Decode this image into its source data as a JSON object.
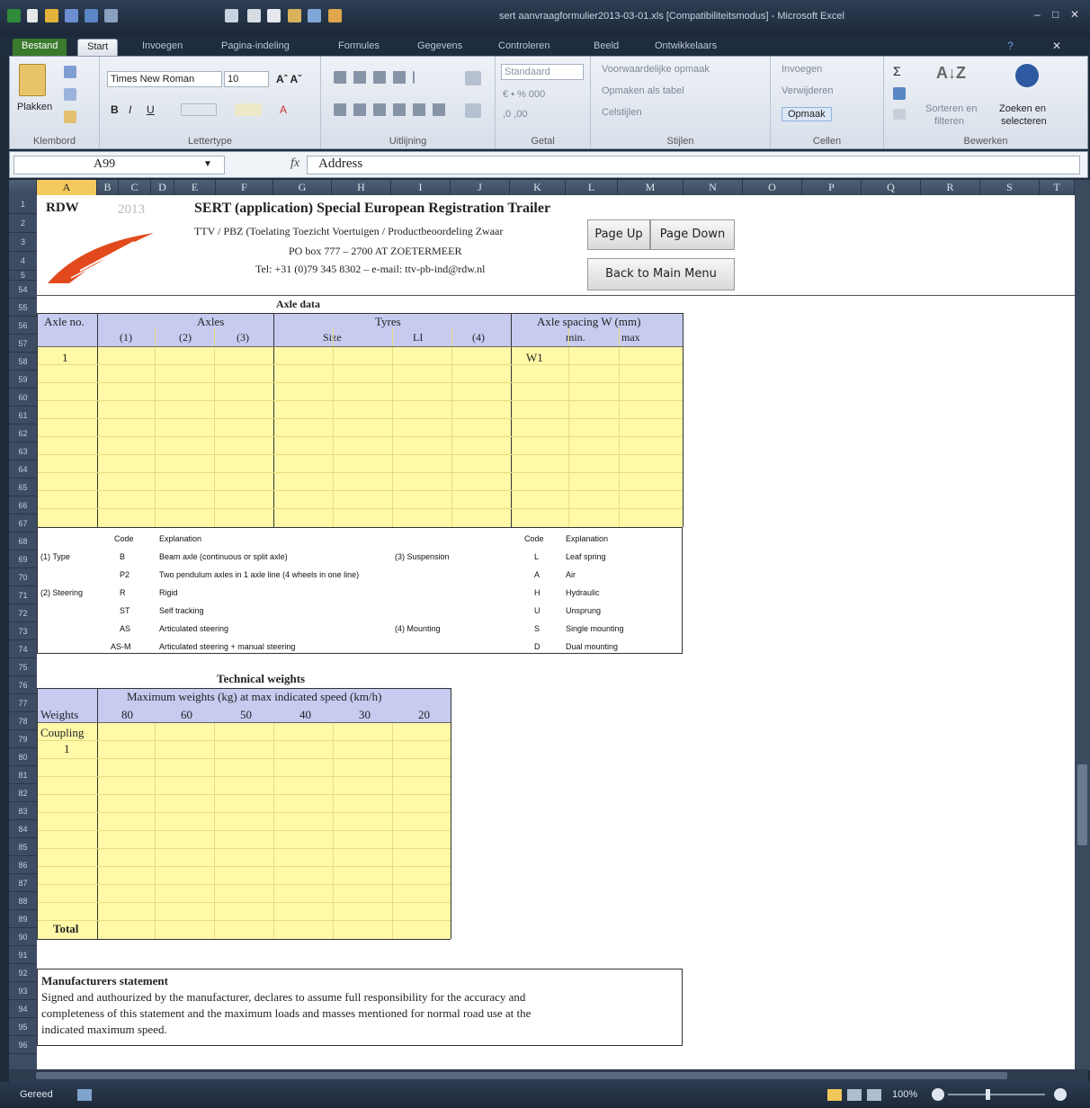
{
  "window": {
    "title": "sert aanvraagformulier2013-03-01.xls  [Compatibiliteitsmodus] - Microsoft Excel"
  },
  "ribbon_tabs": [
    "Bestand",
    "Start",
    "Invoegen",
    "Pagina-indeling",
    "Formules",
    "Gegevens",
    "Controleren",
    "Beeld",
    "Ontwikkelaars"
  ],
  "ribbon": {
    "paste": "Plakken",
    "clipboard": "Klembord",
    "font_name": "Times New Roman",
    "font_size": "10",
    "font_group": "Lettertype",
    "align_group": "Uitlijning",
    "number_format": "Standaard",
    "number_group": "Getal",
    "cond_format": "Voorwaardelijke opmaak",
    "table_format": "Opmaken als tabel",
    "cell_styles": "Celstijlen",
    "styles_group": "Stijlen",
    "insert": "Invoegen",
    "delete": "Verwijderen",
    "format": "Opmaak",
    "cells_group": "Cellen",
    "sort_filter": [
      "Sorteren en",
      "filteren"
    ],
    "find_select": [
      "Zoeken en",
      "selecteren"
    ],
    "edit_group": "Bewerken"
  },
  "formula_bar": {
    "name_box": "A99",
    "fx": "fx",
    "content": "Address"
  },
  "columns": [
    "A",
    "B",
    "C",
    "D",
    "E",
    "F",
    "G",
    "H",
    "I",
    "J",
    "K",
    "L",
    "M",
    "N",
    "O",
    "P",
    "Q",
    "R",
    "S",
    "T"
  ],
  "rows": [
    "1",
    "2",
    "3",
    "4",
    "5",
    "54",
    "55",
    "56",
    "57",
    "58",
    "59",
    "60",
    "61",
    "62",
    "63",
    "64",
    "65",
    "66",
    "67",
    "68",
    "69",
    "70",
    "71",
    "72",
    "73",
    "74",
    "75",
    "76",
    "77",
    "78",
    "79",
    "80",
    "81",
    "82",
    "83",
    "84",
    "85",
    "86",
    "87",
    "88",
    "89",
    "90",
    "91",
    "92",
    "93",
    "94",
    "95",
    "96"
  ],
  "header": {
    "logo": "RDW",
    "year": "2013",
    "title": "SERT (application) Special European Registration Trailer",
    "line1": "TTV / PBZ (Toelating Toezicht Voertuigen / Productbeoordeling Zwaar",
    "line2": "PO box 777 – 2700 AT  ZOETERMEER",
    "line3": "Tel: +31 (0)79 345 8302 – e-mail: ttv-pb-ind@rdw.nl"
  },
  "nav": {
    "page_up": "Page Up",
    "page_down": "Page Down",
    "main_menu": "Back to Main Menu"
  },
  "axle": {
    "section": "Axle data",
    "axle_no": "Axle no.",
    "axles": "Axles",
    "axle_cols": [
      "(1)",
      "(2)",
      "(3)"
    ],
    "tyres": "Tyres",
    "size": "Size",
    "li": "LI",
    "col4": "(4)",
    "spacing": "Axle spacing W (mm)",
    "min": "min.",
    "max": "max",
    "first_no": "1",
    "first_w": "W1"
  },
  "legend": {
    "code_hdr": "Code",
    "expl_hdr": "Explanation",
    "type": "(1) Type",
    "steering": "(2) Steering",
    "suspension": "(3) Suspension",
    "mounting": "(4) Mounting",
    "left": [
      [
        "B",
        "Beam axle (continuous or split axle)"
      ],
      [
        "P2",
        "Two pendulum axles in 1 axle line (4 wheels in one line)"
      ],
      [
        "R",
        "Rigid"
      ],
      [
        "ST",
        "Self tracking"
      ],
      [
        "AS",
        "Articulated steering"
      ],
      [
        "AS-M",
        "Articulated steering + manual steering"
      ]
    ],
    "right": [
      [
        "L",
        "Leaf spring"
      ],
      [
        "A",
        "Air"
      ],
      [
        "H",
        "Hydraulic"
      ],
      [
        "U",
        "Unsprung"
      ],
      [
        "S",
        "Single mounting"
      ],
      [
        "D",
        "Dual mounting"
      ]
    ]
  },
  "weights": {
    "section": "Technical weights",
    "subtitle": "Maximum weights (kg) at max indicated speed (km/h)",
    "label": "Weights",
    "speeds": [
      "80",
      "60",
      "50",
      "40",
      "30",
      "20"
    ],
    "coupling": "Coupling",
    "first": "1",
    "total": "Total"
  },
  "statement": {
    "title": "Manufacturers statement",
    "lines": [
      "Signed and authourized by the manufacturer, declares to assume full responsibility  for the accuracy and",
      "completeness of this statement and the maximum loads and masses mentioned for normal road use at the",
      "indicated maximum speed."
    ]
  },
  "status": {
    "ready": "Gereed",
    "zoom": "100%"
  }
}
